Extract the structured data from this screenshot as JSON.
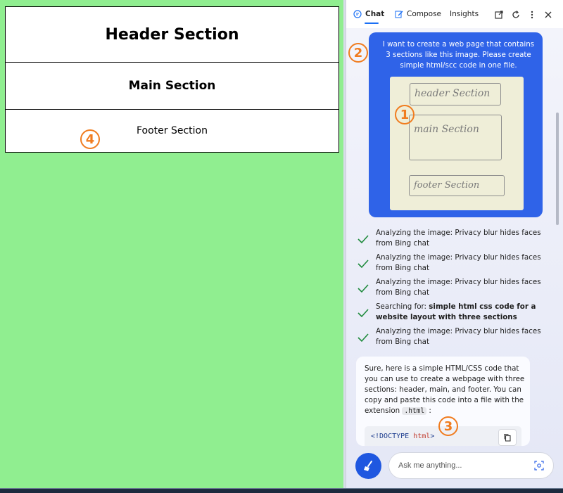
{
  "preview": {
    "header": "Header Section",
    "main": "Main Section",
    "footer": "Footer Section"
  },
  "badges": {
    "one": "1",
    "two": "2",
    "three": "3",
    "four": "4"
  },
  "tabs": {
    "chat": "Chat",
    "compose": "Compose",
    "insights": "Insights"
  },
  "user_message": "I want to create a web page that contains 3 sections like this image. Please create simple html/scc code in one file.",
  "sketch": {
    "header": "header Section",
    "main": "main Section",
    "footer": "footer Section"
  },
  "steps": {
    "s1": "Analyzing the image: Privacy blur hides faces from Bing chat",
    "s2": "Analyzing the image: Privacy blur hides faces from Bing chat",
    "s3": "Analyzing the image: Privacy blur hides faces from Bing chat",
    "s4_prefix": "Searching for: ",
    "s4_query": "simple html css code for a website layout with three sections",
    "s5": "Analyzing the image: Privacy blur hides faces from Bing chat"
  },
  "bot": {
    "text": "Sure, here is a simple HTML/CSS code that you can use to create a webpage with three sections: header, main, and footer. You can copy and paste this code into a file with the extension",
    "inline_code": ".html",
    "colon": ":",
    "code_doctype": "<!DOCTYPE",
    "code_html": "html",
    "code_end": ">"
  },
  "composer": {
    "placeholder": "Ask me anything..."
  },
  "colors": {
    "accent": "#1a6ff5",
    "preview_bg": "#90ee90",
    "badge": "#f07c1f",
    "user_bubble": "#2f63e8"
  }
}
